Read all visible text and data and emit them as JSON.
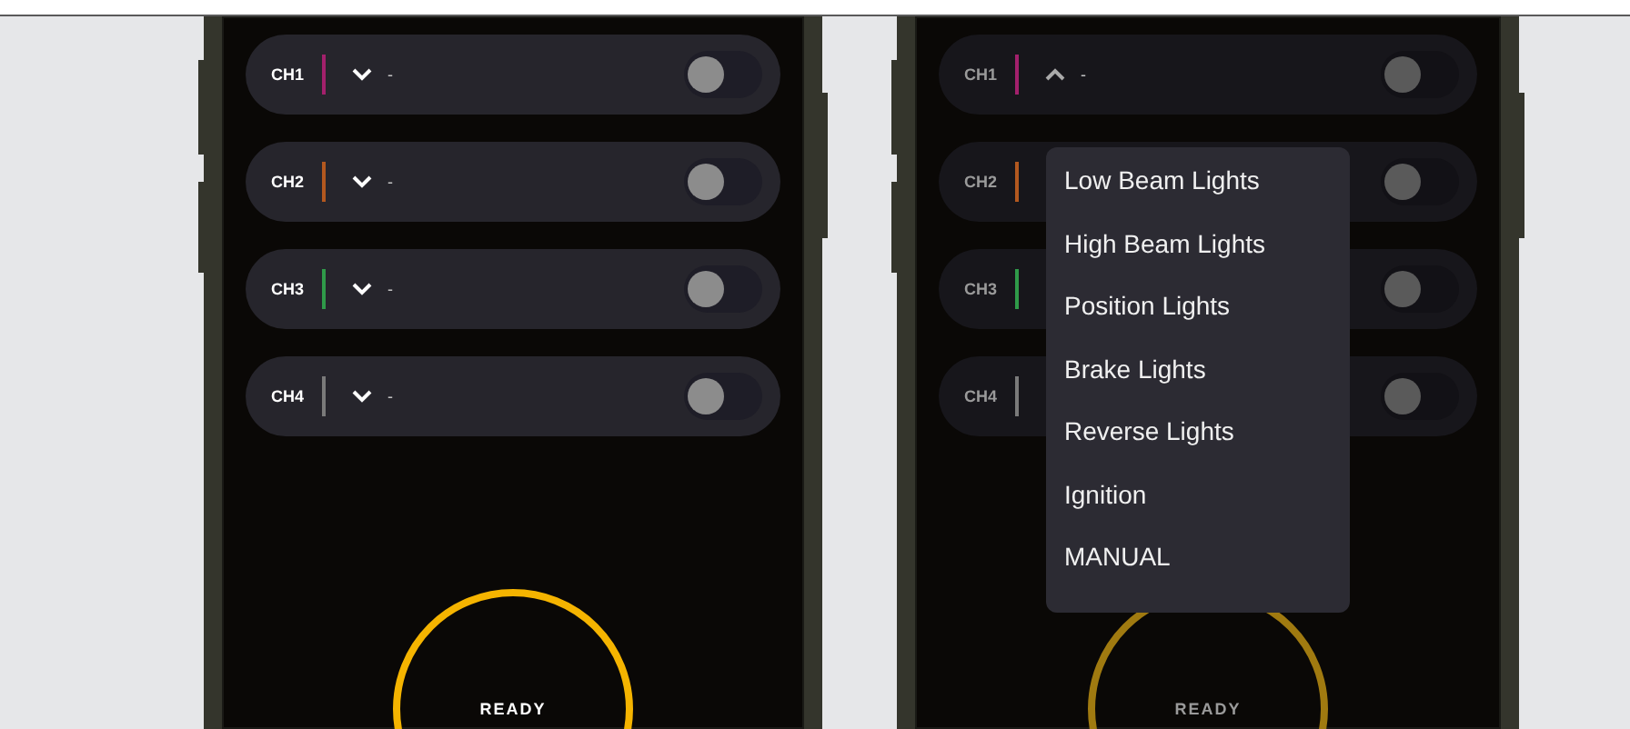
{
  "phones": [
    {
      "channels": [
        {
          "label": "CH1",
          "color": "#a3206c",
          "expanded": false,
          "value": "-",
          "on": false
        },
        {
          "label": "CH2",
          "color": "#b3581f",
          "expanded": false,
          "value": "-",
          "on": false
        },
        {
          "label": "CH3",
          "color": "#2f9a49",
          "expanded": false,
          "value": "-",
          "on": false
        },
        {
          "label": "CH4",
          "color": "#7a7a7a",
          "expanded": false,
          "value": "-",
          "on": false
        }
      ],
      "status": "READY"
    },
    {
      "channels": [
        {
          "label": "CH1",
          "color": "#a3206c",
          "expanded": true,
          "value": "-",
          "on": false
        },
        {
          "label": "CH2",
          "color": "#b3581f",
          "on": false
        },
        {
          "label": "CH3",
          "color": "#2f9a49",
          "on": false
        },
        {
          "label": "CH4",
          "color": "#7a7a7a",
          "on": false
        }
      ],
      "status": "READY",
      "menu": {
        "items": [
          "Low Beam Lights",
          "High Beam Lights",
          "Position Lights",
          "Brake Lights",
          "Reverse Lights",
          "Ignition",
          "MANUAL"
        ]
      }
    }
  ]
}
